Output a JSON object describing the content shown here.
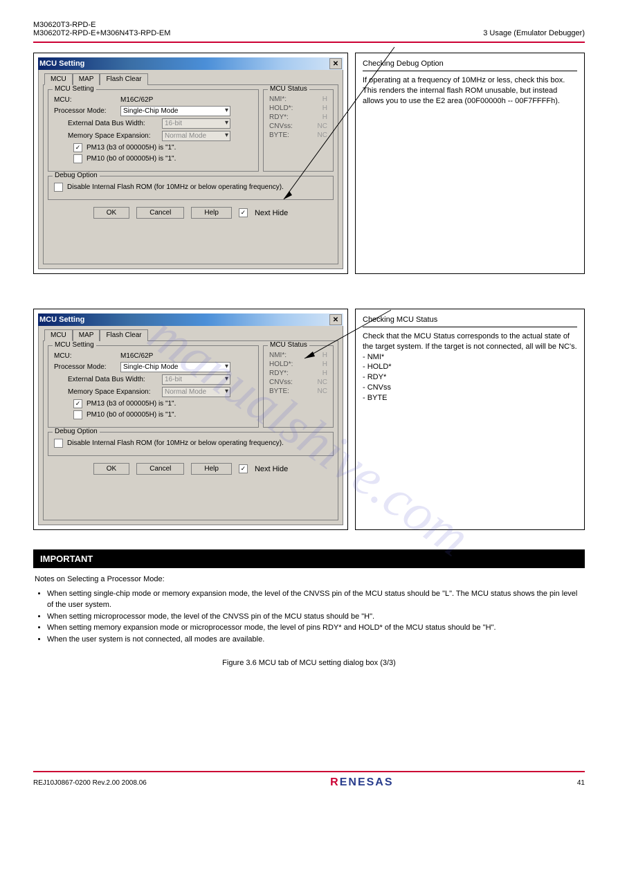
{
  "header": {
    "product_line1": "M30620T3-RPD-E",
    "product_line2": "M30620T2-RPD-E+M306N4T3-RPD-EM",
    "chapter": "3 Usage (Emulator Debugger)"
  },
  "dialog": {
    "title": "MCU Setting",
    "close_glyph": "✕",
    "tabs": [
      "MCU",
      "MAP",
      "Flash Clear"
    ],
    "group_mcu_setting": "MCU Setting",
    "mcu_label": "MCU:",
    "mcu_value": "M16C/62P",
    "processor_mode_label": "Processor Mode:",
    "processor_mode_value": "Single-Chip Mode",
    "ext_bus_label": "External Data Bus Width:",
    "ext_bus_value": "16-bit",
    "mem_exp_label": "Memory Space Expansion:",
    "mem_exp_value": "Normal Mode",
    "pm13_label": "PM13 (b3 of 000005H) is \"1\".",
    "pm10_label": "PM10 (b0 of 000005H) is \"1\".",
    "group_mcu_status": "MCU Status",
    "status": [
      {
        "k": "NMI*:",
        "v": "H"
      },
      {
        "k": "HOLD*:",
        "v": "H"
      },
      {
        "k": "RDY*:",
        "v": "H"
      },
      {
        "k": "CNVss:",
        "v": "NC"
      },
      {
        "k": "BYTE:",
        "v": "NC"
      }
    ],
    "group_debug_option": "Debug Option",
    "debug_chk_label": "Disable Internal Flash ROM (for 10MHz or below operating frequency).",
    "next_hide": "Next Hide",
    "buttons": {
      "ok": "OK",
      "cancel": "Cancel",
      "help": "Help"
    }
  },
  "sideA": {
    "title": "Checking Debug Option",
    "body": "If operating at a frequency of 10MHz or less, check this box. This renders the internal flash ROM unusable, but instead allows you to use the E2 area (00F00000h -- 00F7FFFFh)."
  },
  "sideB": {
    "title": "Checking MCU Status",
    "body": "Check that the MCU Status corresponds to the actual state of the target system. If the target is not connected, all will be NC's.\n- NMI*\n- HOLD*\n- RDY*\n- CNVss\n- BYTE"
  },
  "important": {
    "bar": "IMPORTANT",
    "heading": "Notes on Selecting a Processor Mode:",
    "bullets": [
      "When setting single-chip mode or memory expansion mode, the level of the CNVSS pin of the MCU status should be \"L\". The MCU status shows the pin level of the user system.",
      "When setting microprocessor mode, the level of the CNVSS pin of the MCU status should be \"H\".",
      "When setting memory expansion mode or microprocessor mode, the level of pins RDY* and HOLD* of the MCU status should be \"H\".",
      "When the user system is not connected, all modes are available."
    ]
  },
  "caption": "Figure 3.6  MCU tab of MCU setting dialog box (3/3)",
  "footer": {
    "rev": "REJ10J0867-0200  Rev.2.00  2008.06",
    "page": "41"
  },
  "watermark": "manualshive.com"
}
